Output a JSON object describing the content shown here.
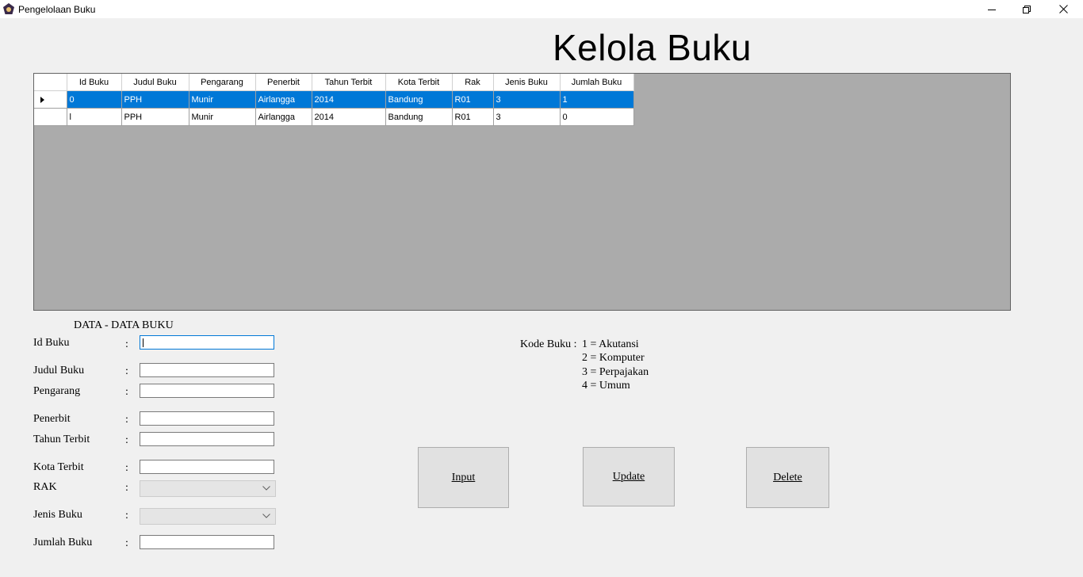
{
  "window": {
    "title": "Pengelolaan Buku"
  },
  "heading": "Kelola Buku",
  "grid": {
    "columns": [
      "Id Buku",
      "Judul Buku",
      "Pengarang",
      "Penerbit",
      "Tahun Terbit",
      "Kota Terbit",
      "Rak",
      "Jenis Buku",
      "Jumlah Buku"
    ],
    "rows": [
      [
        "0",
        "PPH",
        "Munir",
        "Airlangga",
        "2014",
        "Bandung",
        "R01",
        "3",
        "1"
      ],
      [
        "l",
        "PPH",
        "Munir",
        "Airlangga",
        "2014",
        "Bandung",
        "R01",
        "3",
        "0"
      ]
    ],
    "selected_row": 0
  },
  "form": {
    "section_title": "DATA - DATA BUKU",
    "colon": ":",
    "labels": {
      "id_buku": "Id Buku",
      "judul_buku": "Judul Buku",
      "pengarang": "Pengarang",
      "penerbit": "Penerbit",
      "tahun_terbit": "Tahun Terbit",
      "kota_terbit": "Kota Terbit",
      "rak": "RAK",
      "jenis_buku": "Jenis Buku",
      "jumlah_buku": "Jumlah Buku"
    },
    "values": {
      "id_buku": "",
      "judul_buku": "",
      "pengarang": "",
      "penerbit": "",
      "tahun_terbit": "",
      "kota_terbit": "",
      "rak": "",
      "jenis_buku": "",
      "jumlah_buku": ""
    }
  },
  "kode_buku": {
    "label": "Kode Buku :",
    "items": [
      "1 = Akutansi",
      "2 = Komputer",
      "3 = Perpajakan",
      "4 = Umum"
    ]
  },
  "buttons": {
    "input": {
      "first": "I",
      "rest": "nput"
    },
    "update": {
      "first": "U",
      "rest": "pdate"
    },
    "delete": {
      "first": "D",
      "rest": "elete"
    }
  },
  "colors": {
    "selection": "#0078d7",
    "grid_background": "#ababab",
    "window_background": "#f0f0f0"
  }
}
